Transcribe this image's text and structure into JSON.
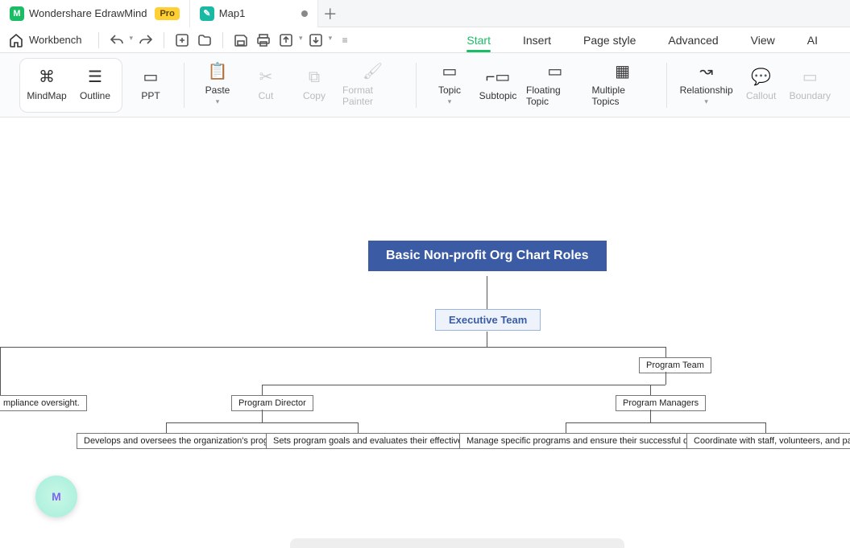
{
  "tabs": {
    "app_name": "Wondershare EdrawMind",
    "pro_badge": "Pro",
    "doc_name": "Map1"
  },
  "quickbar": {
    "workbench": "Workbench"
  },
  "menu": {
    "start": "Start",
    "insert": "Insert",
    "page_style": "Page style",
    "advanced": "Advanced",
    "view": "View",
    "ai": "AI"
  },
  "ribbon": {
    "mindmap": "MindMap",
    "outline": "Outline",
    "ppt": "PPT",
    "paste": "Paste",
    "cut": "Cut",
    "copy": "Copy",
    "format_painter": "Format Painter",
    "topic": "Topic",
    "subtopic": "Subtopic",
    "floating_topic": "Floating Topic",
    "multiple_topics": "Multiple Topics",
    "relationship": "Relationship",
    "callout": "Callout",
    "boundary": "Boundary"
  },
  "diagram": {
    "root": "Basic Non-profit Org Chart Roles",
    "executive_team": "Executive Team",
    "program_team": "Program Team",
    "compliance_frag": "mpliance oversight.",
    "program_director": "Program Director",
    "program_managers": "Program Managers",
    "pd_leaf1": "Develops and oversees the organization's programs.",
    "pd_leaf2": "Sets program goals and evaluates their effectiveness.",
    "pm_leaf1": "Manage specific programs and ensure their successful delivery.",
    "pm_leaf2": "Coordinate with staff, volunteers, and partners."
  },
  "ai_fab": "M"
}
